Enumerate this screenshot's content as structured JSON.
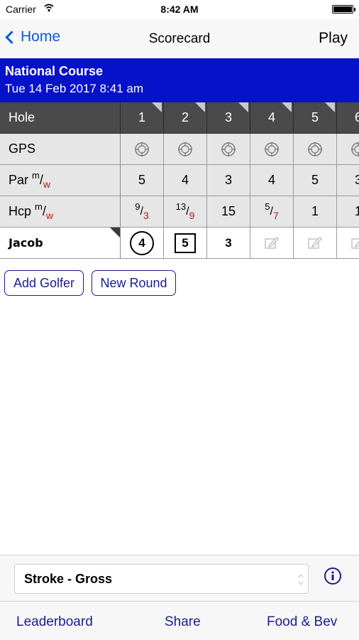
{
  "status_bar": {
    "carrier": "Carrier",
    "time": "8:42 AM"
  },
  "nav": {
    "back_label": "Home",
    "title": "Scorecard",
    "action_label": "Play"
  },
  "course": {
    "name": "National Course",
    "datetime": "Tue 14 Feb 2017 8:41 am"
  },
  "scorecard": {
    "hole_label": "Hole",
    "gps_label": "GPS",
    "par_label": "Par",
    "hcp_label": "Hcp",
    "gender_m": "m",
    "gender_w": "w",
    "holes": [
      "1",
      "2",
      "3",
      "4",
      "5",
      "6"
    ],
    "par": [
      "5",
      "4",
      "3",
      "4",
      "5",
      "3"
    ],
    "hcp": [
      {
        "m": "9",
        "w": "3"
      },
      {
        "m": "13",
        "w": "9"
      },
      {
        "single": "15"
      },
      {
        "m": "5",
        "w": "7"
      },
      {
        "single": "1"
      },
      {
        "single": "1"
      }
    ],
    "golfer": {
      "name": "Jacob",
      "scores": [
        "4",
        "5",
        "3",
        "",
        "",
        ""
      ],
      "score_marks": [
        "circle",
        "square",
        "plain",
        "edit",
        "edit",
        "edit"
      ]
    }
  },
  "buttons": {
    "add_golfer": "Add Golfer",
    "new_round": "New Round"
  },
  "format": {
    "selected": "Stroke - Gross"
  },
  "tabs": {
    "leaderboard": "Leaderboard",
    "share": "Share",
    "food_bev": "Food & Bev"
  },
  "colors": {
    "header_blue": "#0612c9",
    "link_blue": "#0a5bd6",
    "button_blue": "#1c1c8f",
    "hole_row": "#4a4a4a",
    "w_red": "#c21616"
  }
}
